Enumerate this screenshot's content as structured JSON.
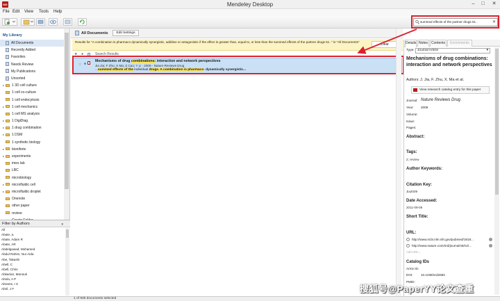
{
  "window": {
    "title": "Mendeley Desktop",
    "logo": "MD",
    "minimize": "–",
    "maximize": "□",
    "close": "✕"
  },
  "menu": {
    "file": "File",
    "edit": "Edit",
    "view": "View",
    "tools": "Tools",
    "help": "Help"
  },
  "search": {
    "value": "summed effects of the partner drugs 51 ."
  },
  "sidebar": {
    "header": "My Library",
    "items": [
      {
        "label": "All Documents",
        "active": true
      },
      {
        "label": "Recently Added"
      },
      {
        "label": "Favorites"
      },
      {
        "label": "Needs Review"
      },
      {
        "label": "My Publications"
      },
      {
        "label": "Unsorted"
      },
      {
        "label": "1 3D cell culture"
      },
      {
        "label": "1 cell co-culture"
      },
      {
        "label": "1 cell endocytosis"
      },
      {
        "label": "1 cell mechanics"
      },
      {
        "label": "1 cell MS analysis"
      },
      {
        "label": "1 DigiDiag"
      },
      {
        "label": "1 drug combination"
      },
      {
        "label": "1 DSM"
      },
      {
        "label": "1 synthetic biology"
      },
      {
        "label": "bioniferie"
      },
      {
        "label": "experiments"
      },
      {
        "label": "imes lab"
      },
      {
        "label": "LBC"
      },
      {
        "label": "microbiology"
      },
      {
        "label": "microfluidic cell"
      },
      {
        "label": "microfluidic droplet"
      },
      {
        "label": "Onenote"
      },
      {
        "label": "other paper"
      },
      {
        "label": "review"
      },
      {
        "label": "Create Folder..."
      }
    ]
  },
  "filter": {
    "title": "Filter by Authors",
    "authors": [
      "All",
      "Abate, a.",
      "Abate, Adam R",
      "Abate, AR",
      "Abdelgawad, Mohamed",
      "Abdul Rahim, Nur Aida",
      "Abe, Takashi",
      "Abell, C",
      "Abell, Chris",
      "Abkarian, Manouk",
      "Abola, A P",
      "Abrams, I S",
      "Abril, J F"
    ]
  },
  "center": {
    "header_title": "All Documents",
    "edit_settings": "Edit Settings",
    "results_text": "Results for \"A combination is pharmaco dynamically synergistic, additive or antagonistic if the effect is greater than, equal to, or less than the summed effects of the partner drugs 51 .\" in \"All Documents\"",
    "clear_label": "Clear",
    "column_label": "Search Results",
    "row": {
      "title_pre": "Mechanisms of drug ",
      "title_hl": "combinations",
      "title_post": ": interaction and network perspectives",
      "meta": "Jia Jia; F Zhu; X Ma; Z Cao; Y Li - 2009 - Nature Reviews Drug",
      "snippet_a": "...",
      "snippet_b": "summed effects of the",
      "snippet_c": " individual ",
      "snippet_d": "drugs",
      "snippet_e": ". A combination is pharmaco",
      "snippet_f": "- dynamically synergistic..."
    }
  },
  "details": {
    "tabs": [
      "Details",
      "Notes",
      "Contents",
      "Enrichments"
    ],
    "type_label": "Type:",
    "type_value": "Journal Article",
    "title": "Mechanisms of drug combinations: interaction and network perspectives",
    "authors_label": "Authors:",
    "authors_value": "J. Jia, F. Zhu, X. Ma et al.",
    "catalog_button": "View research catalog entry for this paper",
    "journal_label": "Journal:",
    "journal_value": "Nature Reviews Drug",
    "year_label": "Year:",
    "year_value": "2009",
    "volume_label": "Volume:",
    "issue_label": "Issue:",
    "pages_label": "Pages:",
    "abstract_label": "Abstract:",
    "tags_label": "Tags:",
    "tags_value": "2; review",
    "keywords_label": "Author Keywords:",
    "citation_label": "Citation Key:",
    "citation_value": "Jia2009",
    "accessed_label": "Date Accessed:",
    "accessed_value": "2011-09-08",
    "short_title_label": "Short Title:",
    "url_label": "URL:",
    "url1": "http://www.ncbi.nlm.nih.gov/pubmed/1918...",
    "url2": "http://www.nature.com/nrd/journal/v8/n2/...",
    "add_url": "Add URL...",
    "catalog_ids_label": "Catalog IDs",
    "arxiv_label": "ArXiv ID:",
    "doi_label": "DOI:",
    "doi_value": "10.1038/nrd2683",
    "pmid_label": "PMID:"
  },
  "status": {
    "text": "1 of 948 documents selected"
  },
  "watermark": {
    "text": "搜狐号@PaperYY论文查重"
  },
  "colors": {
    "annotation_red": "#d9212f",
    "highlight": "#f5e36a",
    "selection_blue": "#c9e0f5",
    "banner_yellow": "#fdf4c3"
  }
}
